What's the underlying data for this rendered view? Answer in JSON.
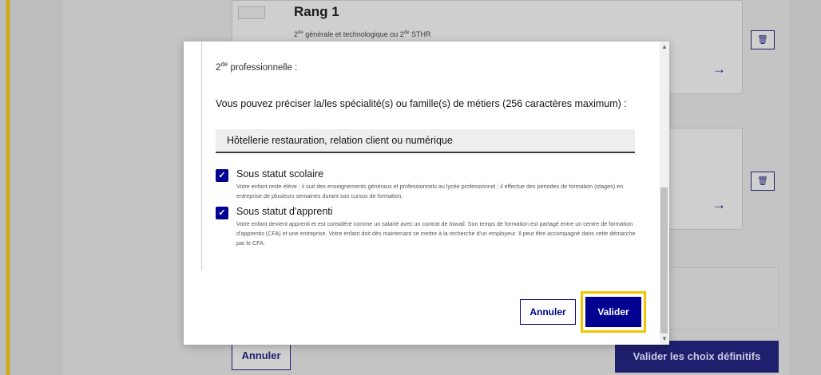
{
  "background": {
    "rank_title": "Rang 1",
    "rank_subtitle_parts": {
      "a": "2",
      "b": "de",
      "c": " générale et technologique ou 2",
      "d": "de",
      "e": " STHR"
    },
    "trash_icon": "trash-icon",
    "arrow_icon": "arrow-right-icon",
    "arrow_glyph": "→",
    "trash_glyph": "🗑",
    "cancel_label": "Annuler",
    "validate_all_label": "Valider les choix définitifs",
    "accent_color": "#d8a800"
  },
  "modal": {
    "field_label": {
      "base": "2",
      "sup": "de",
      "rest": " professionnelle :"
    },
    "precise_label": "Vous pouvez préciser la/les spécialité(s) ou famille(s) de métiers (256 caractères maximum) :",
    "precise_value": "Hôtellerie restauration, relation client ou numérique",
    "options": [
      {
        "title": "Sous statut scolaire",
        "checked": true,
        "description": "Votre enfant reste élève ; il suit des enseignements généraux et professionnels au lycée professionnel ; il effectue des périodes de formation (stages) en entreprise de plusieurs semaines durant son cursus de formation."
      },
      {
        "title": "Sous statut d'apprenti",
        "checked": true,
        "description": "Votre enfant devient apprenti et est considéré comme un salarié avec un contrat de travail. Son temps de formation est partagé entre un centre de formation d'apprentis (CFA) et une entreprise. Votre enfant doit dès maintenant se mettre à la recherche d'un employeur. Il peut être accompagné dans cette démarche par le CFA."
      }
    ],
    "checkmark_glyph": "✓",
    "cancel_label": "Annuler",
    "validate_label": "Valider",
    "primary_color": "#000091",
    "highlight_color": "#f2c500",
    "scroll_up_glyph": "▲",
    "scroll_down_glyph": "▼"
  }
}
